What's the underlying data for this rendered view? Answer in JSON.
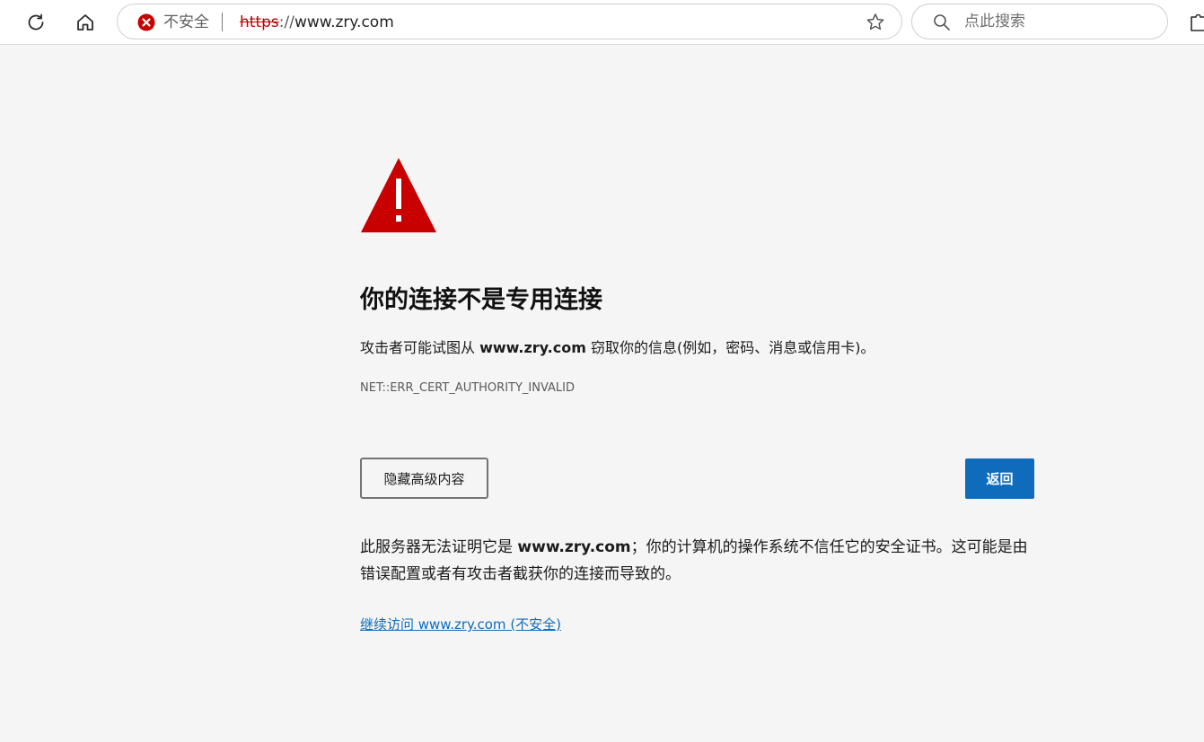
{
  "browser": {
    "security_label": "不安全",
    "url_scheme": "https",
    "url_separator": "://",
    "url_host": "www.zry.com",
    "search_placeholder": "点此搜索",
    "accent_color": "#0f6cbd",
    "warning_color": "#c80000"
  },
  "page": {
    "title": "你的连接不是专用连接",
    "desc_before": "攻击者可能试图从 ",
    "desc_host": "www.zry.com",
    "desc_after": " 窃取你的信息(例如，密码、消息或信用卡)。",
    "error_code": "NET::ERR_CERT_AUTHORITY_INVALID",
    "hide_advanced_label": "隐藏高级内容",
    "back_label": "返回",
    "detail_before": "此服务器无法证明它是 ",
    "detail_host": "www.zry.com",
    "detail_after": "；你的计算机的操作系统不信任它的安全证书。这可能是由错误配置或者有攻击者截获你的连接而导致的。",
    "proceed_link": "继续访问 www.zry.com (不安全)"
  },
  "icons": [
    "refresh-icon",
    "home-icon",
    "not-secure-icon",
    "favorite-star-icon",
    "search-icon",
    "extensions-icon",
    "warning-triangle-icon"
  ]
}
